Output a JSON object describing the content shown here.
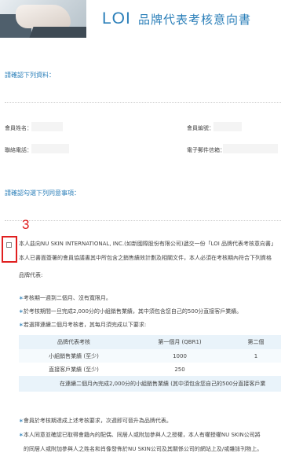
{
  "header": {
    "logo": "LOI",
    "title": "品牌代表考核意向書"
  },
  "section1": {
    "title": "請確認下列資料："
  },
  "fields": {
    "member_name": "會員姓名：",
    "member_id": "會員編號：",
    "phone": "聯絡電話：",
    "email": "電子郵件信箱："
  },
  "section2": {
    "title": "請確認勾選下列同意事項："
  },
  "marker": "3",
  "agreement": {
    "line1": "本人茲向NU SKIN INTERNATIONAL, INC.(如新國際股份有限公司)遞交一份「LOI 品牌代表考核意向書」",
    "line2": "本人已書面簽署的會員協議書其中所包含之銷售績效計劃及相關文件，本人必須在考核期內符合下列資格",
    "line3": "品牌代表:"
  },
  "bullets": [
    "考核期一週到二個月、沒有寬限月。",
    "於考核期間一旦完成2,000分的小組銷售業績，其中須包含您自己的500分直接客戶業績。",
    "若選擇連續二個月考核者，其每月須完成以下要求:"
  ],
  "table": {
    "headers": [
      "品牌代表考核",
      "第一個月 (QBR1)",
      "第二個"
    ],
    "rows": [
      [
        "小組銷售業績 (至少)",
        "1000",
        "1"
      ],
      [
        "直接客戶業績 (至少)",
        "250",
        ""
      ]
    ],
    "footer": "在連續二個月內完成2,000分的小組銷售業績 (其中須包含您自己的500分直接客戶業"
  },
  "bottom_bullets": [
    "會員於考核期達成上述考核要求，次週即可晉升為品牌代表。",
    "本人同意並確認已取得會籍內的配偶、同居人或附加參與人之授權，本人有權授權NU SKIN公司將",
    "的同居人或附加參與人之姓名和肖像發佈於NU SKIN公司及其關係公司的網站上及/或雜誌刊物上。"
  ]
}
